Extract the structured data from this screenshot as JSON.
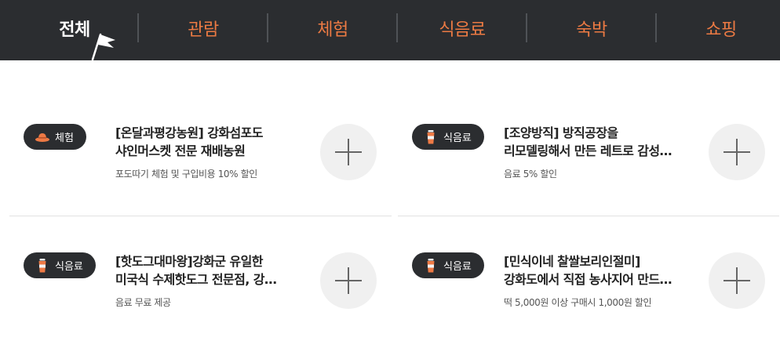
{
  "tabs": [
    {
      "label": "전체",
      "active": true
    },
    {
      "label": "관람",
      "active": false
    },
    {
      "label": "체험",
      "active": false
    },
    {
      "label": "식음료",
      "active": false
    },
    {
      "label": "숙박",
      "active": false
    },
    {
      "label": "쇼핑",
      "active": false
    }
  ],
  "cards": [
    {
      "badge": {
        "label": "체험",
        "icon": "hat-icon"
      },
      "title_line1": "[온달과평강농원] 강화섬포도",
      "title_line2": "샤인머스켓 전문 재배농원",
      "benefit": "포도따기 체험 및 구입비용 10% 할인"
    },
    {
      "badge": {
        "label": "식음료",
        "icon": "drink-cup-icon"
      },
      "title_line1": "[조양방직] 방직공장을",
      "title_line2": "리모델링해서 만든 레트로 감성…",
      "benefit": "음료 5% 할인"
    },
    {
      "badge": {
        "label": "식음료",
        "icon": "drink-cup-icon"
      },
      "title_line1": "[핫도그대마왕]강화군 유일한",
      "title_line2": "미국식 수제핫도그 전문점, 강…",
      "benefit": "음료 무료 제공"
    },
    {
      "badge": {
        "label": "식음료",
        "icon": "drink-cup-icon"
      },
      "title_line1": "[민식이네 찰쌀보리인절미]",
      "title_line2": "강화도에서 직접 농사지어 만드…",
      "benefit": "떡 5,000원 이상 구매시 1,000원 할인"
    }
  ],
  "colors": {
    "header_bg": "#2b2d30",
    "tab_accent": "#ec7a43",
    "badge_bg": "#2b2d30",
    "plus_bg": "#f0f0f0"
  }
}
